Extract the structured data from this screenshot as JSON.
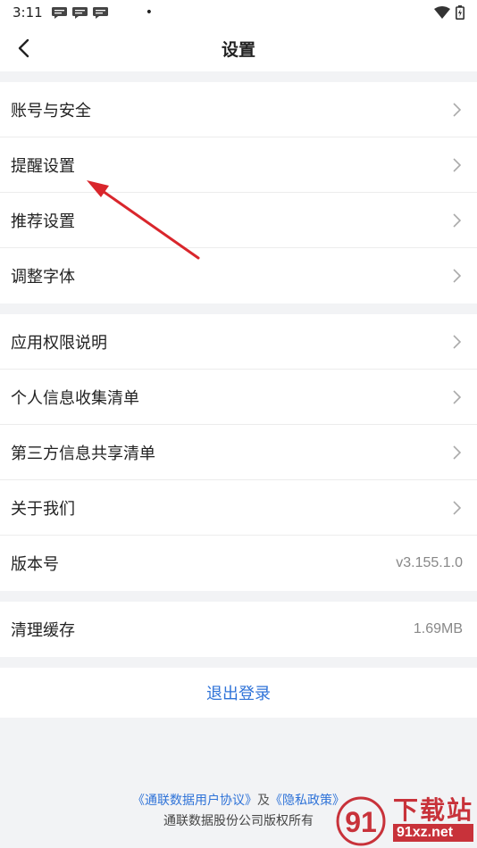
{
  "status_bar": {
    "time": "3:11",
    "dot": "•"
  },
  "nav": {
    "title": "设置"
  },
  "groups": [
    {
      "items": [
        {
          "label": "账号与安全"
        },
        {
          "label": "提醒设置"
        },
        {
          "label": "推荐设置"
        },
        {
          "label": "调整字体"
        }
      ]
    },
    {
      "items": [
        {
          "label": "应用权限说明"
        },
        {
          "label": "个人信息收集清单"
        },
        {
          "label": "第三方信息共享清单"
        },
        {
          "label": "关于我们"
        },
        {
          "label": "版本号",
          "value": "v3.155.1.0"
        }
      ]
    },
    {
      "items": [
        {
          "label": "清理缓存",
          "value": "1.69MB"
        }
      ]
    }
  ],
  "logout": {
    "label": "退出登录"
  },
  "footer": {
    "user_agreement": "《通联数据用户协议》",
    "and_text": "及",
    "privacy_policy": "《隐私政策》",
    "copyright": "通联数据股份公司版权所有"
  },
  "watermark": {
    "cn": "下载站",
    "en": "91xz.net",
    "logo_text": "91"
  },
  "colors": {
    "link": "#2f73d8",
    "annotation_arrow": "#d9262c",
    "watermark": "#c8323a"
  }
}
